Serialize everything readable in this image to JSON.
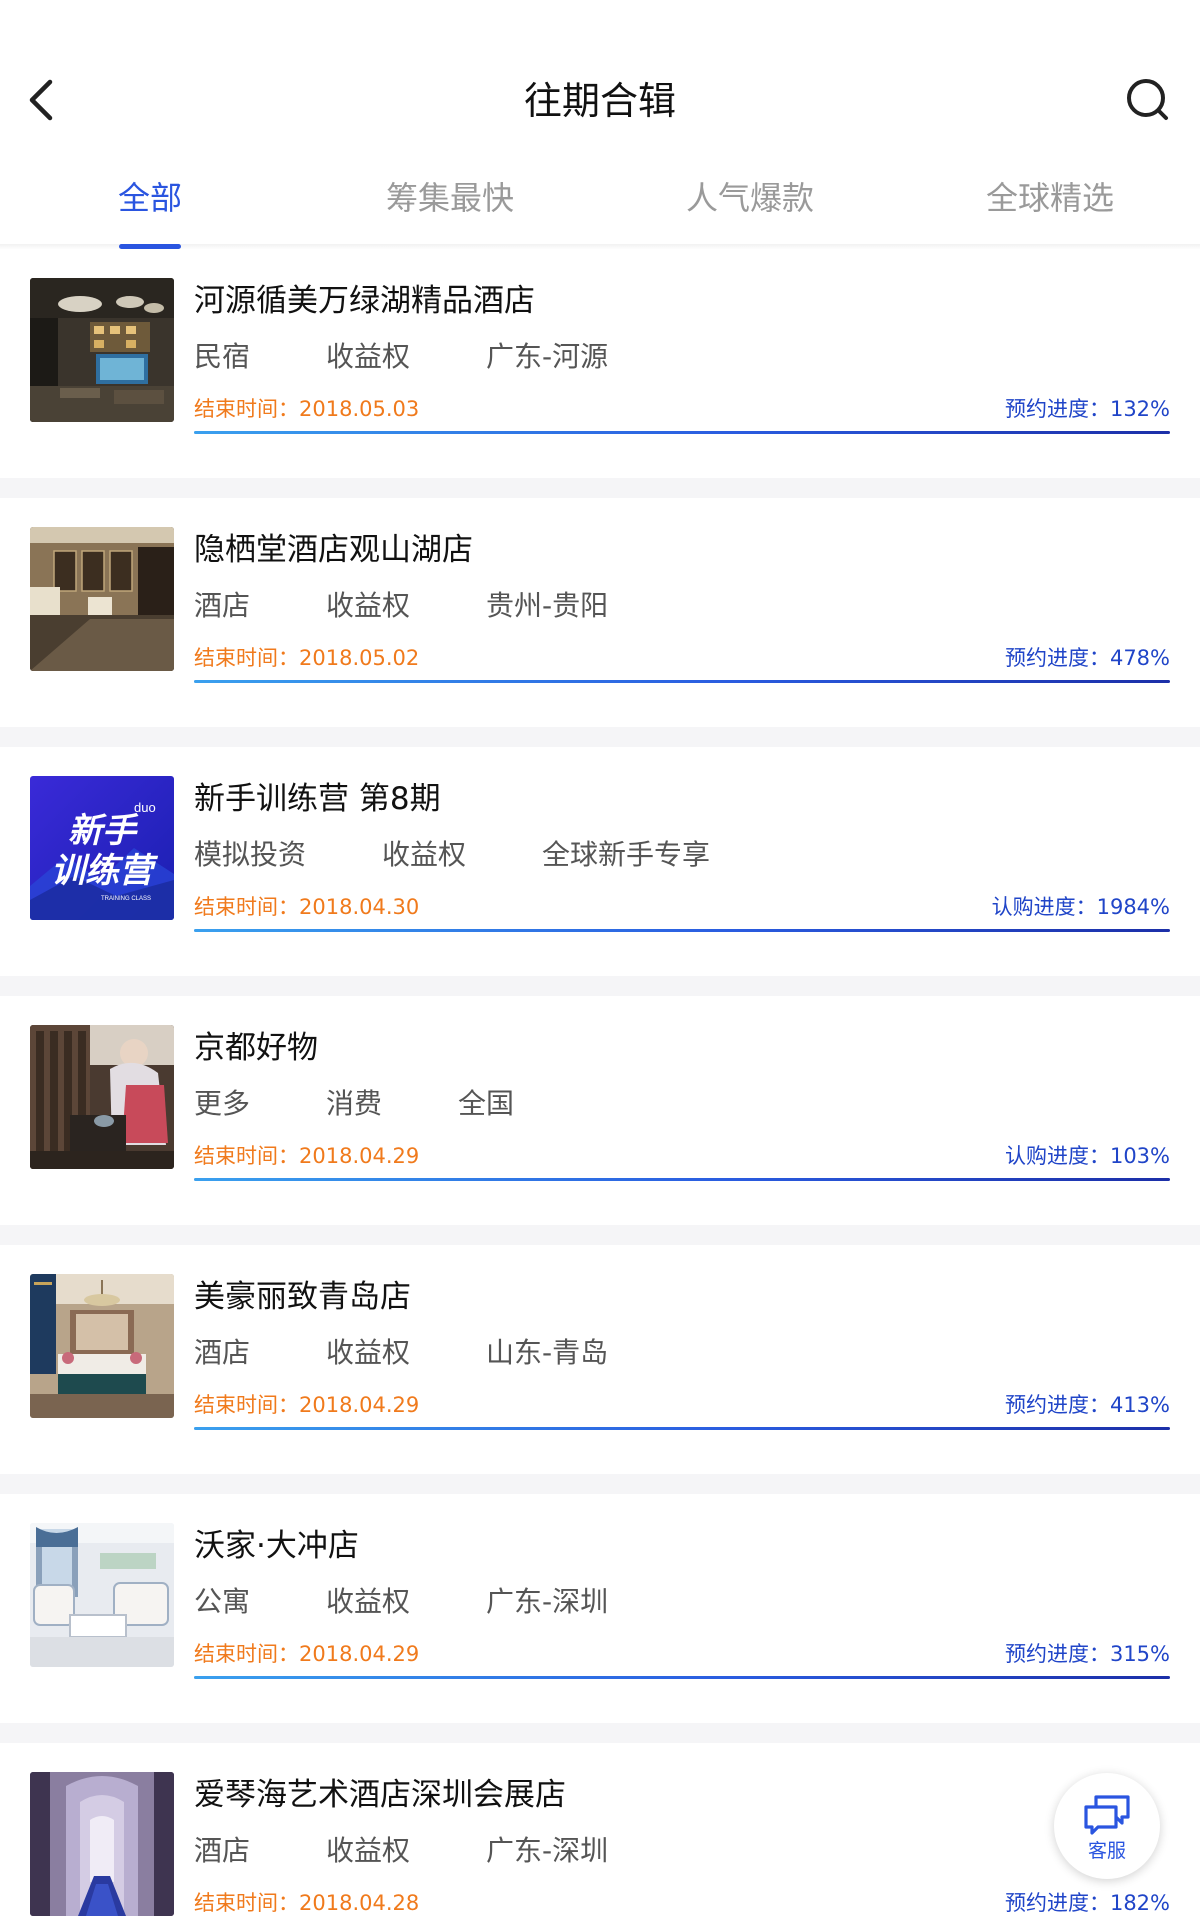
{
  "header": {
    "title": "往期合辑"
  },
  "tabs": [
    {
      "label": "全部",
      "active": true
    },
    {
      "label": "筹集最快",
      "active": false
    },
    {
      "label": "人气爆款",
      "active": false
    },
    {
      "label": "全球精选",
      "active": false
    }
  ],
  "items": [
    {
      "title": "河源循美万绿湖精品酒店",
      "tags": [
        "民宿",
        "收益权",
        "广东-河源"
      ],
      "end_label": "结束时间：",
      "end_date": "2018.05.03",
      "progress_label": "预约进度：",
      "progress_value": "132%",
      "image": "hotel-lobby-image"
    },
    {
      "title": "隐栖堂酒店观山湖店",
      "tags": [
        "酒店",
        "收益权",
        "贵州-贵阳"
      ],
      "end_label": "结束时间：",
      "end_date": "2018.05.02",
      "progress_label": "预约进度：",
      "progress_value": "478%",
      "image": "hotel-room-image"
    },
    {
      "title": "新手训练营 第8期",
      "tags": [
        "模拟投资",
        "收益权",
        "全球新手专享"
      ],
      "end_label": "结束时间：",
      "end_date": "2018.04.30",
      "progress_label": "认购进度：",
      "progress_value": "1984%",
      "image": "training-camp-banner",
      "banner_text": {
        "line1": "新手",
        "line2": "训练营",
        "brand": "duo",
        "sub": "TRAINING CLASS"
      }
    },
    {
      "title": "京都好物",
      "tags": [
        "更多",
        "消费",
        "全国"
      ],
      "end_label": "结束时间：",
      "end_date": "2018.04.29",
      "progress_label": "认购进度：",
      "progress_value": "103%",
      "image": "kyoto-craft-image"
    },
    {
      "title": "美豪丽致青岛店",
      "tags": [
        "酒店",
        "收益权",
        "山东-青岛"
      ],
      "end_label": "结束时间：",
      "end_date": "2018.04.29",
      "progress_label": "预约进度：",
      "progress_value": "413%",
      "image": "bedroom-image"
    },
    {
      "title": "沃家·大冲店",
      "tags": [
        "公寓",
        "收益权",
        "广东-深圳"
      ],
      "end_label": "结束时间：",
      "end_date": "2018.04.29",
      "progress_label": "预约进度：",
      "progress_value": "315%",
      "image": "living-room-image"
    },
    {
      "title": "爱琴海艺术酒店深圳会展店",
      "tags": [
        "酒店",
        "收益权",
        "广东-深圳"
      ],
      "end_label": "结束时间：",
      "end_date": "2018.04.28",
      "progress_label": "预约进度：",
      "progress_value": "182%",
      "image": "corridor-image"
    }
  ],
  "service_button": {
    "label": "客服",
    "icon": "chat-bubbles-icon"
  },
  "colors": {
    "accent": "#2a55e0",
    "end_time": "#f07a1c",
    "progress_text": "#2045c8",
    "inactive_tab": "#9a9a9a"
  }
}
